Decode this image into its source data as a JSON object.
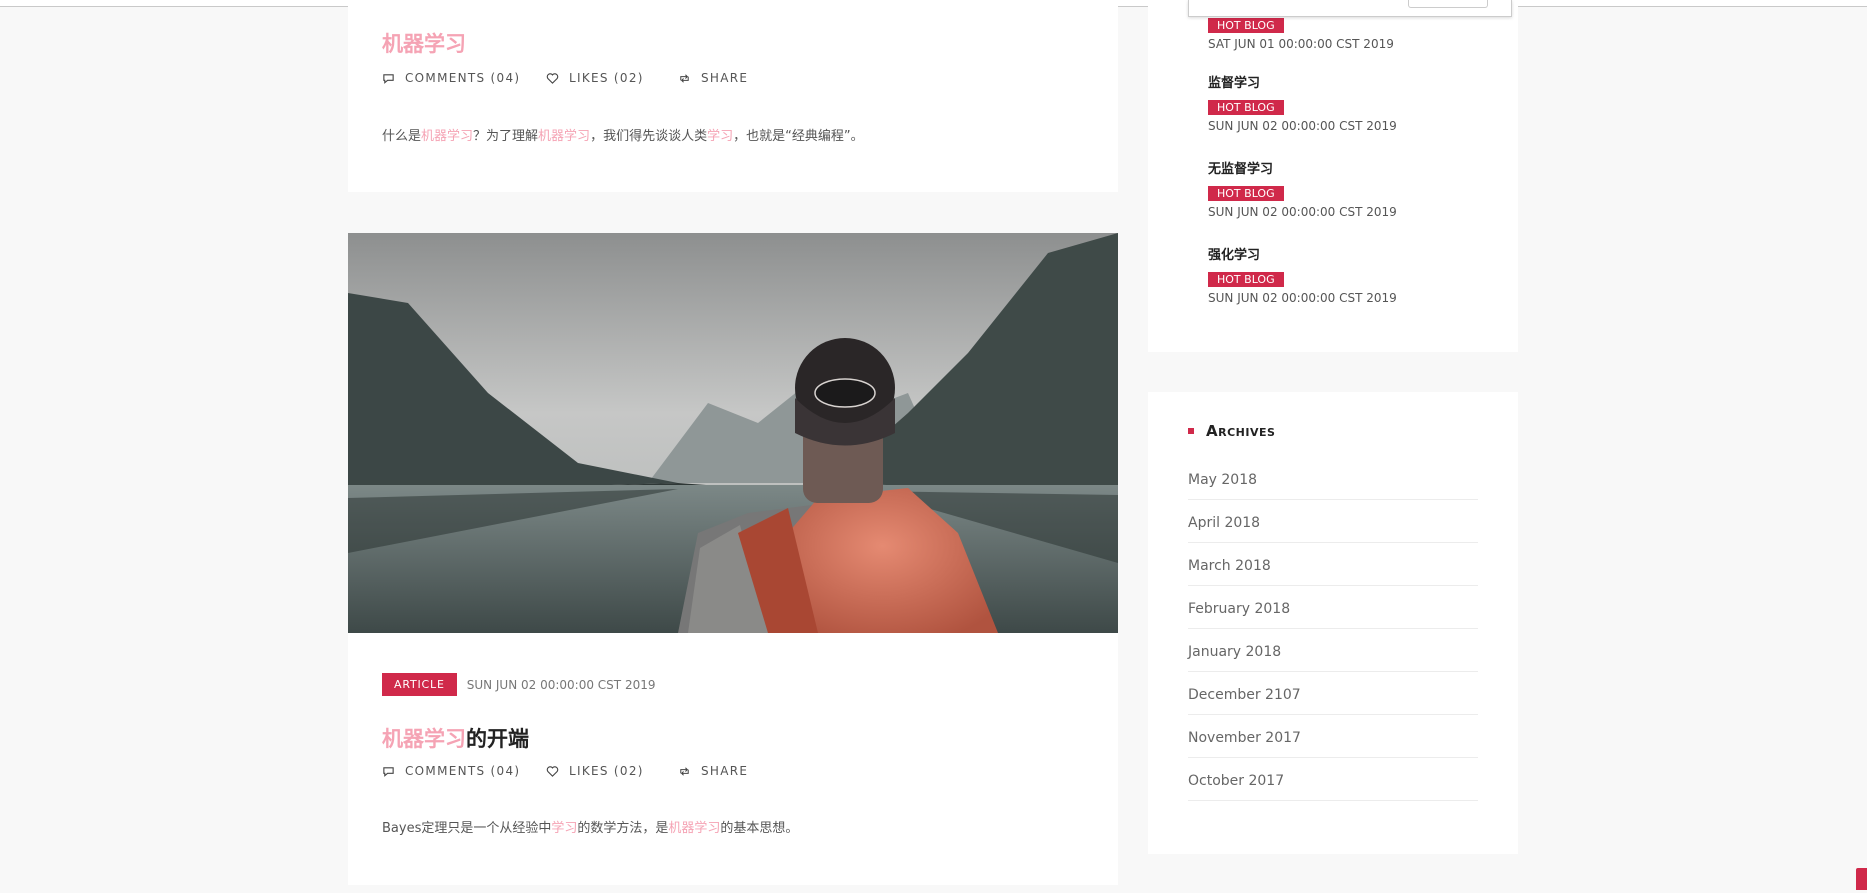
{
  "posts": [
    {
      "title_hl": "机器学习",
      "title_rest": "",
      "comments": "COMMENTS (04)",
      "likes": "LIKES (02)",
      "share": "SHARE",
      "excerpt": [
        {
          "t": "什么是",
          "hl": false
        },
        {
          "t": "机器学习",
          "hl": true
        },
        {
          "t": "？为了理解",
          "hl": false
        },
        {
          "t": "机器学习",
          "hl": true
        },
        {
          "t": "，我们得先谈谈人类",
          "hl": false
        },
        {
          "t": "学习",
          "hl": true
        },
        {
          "t": "，也就是“经典编程”。",
          "hl": false
        }
      ]
    },
    {
      "tag": "ARTICLE",
      "date": "SUN JUN 02 00:00:00 CST 2019",
      "title_hl": "机器学习",
      "title_rest": "的开端",
      "comments": "COMMENTS (04)",
      "likes": "LIKES (02)",
      "share": "SHARE",
      "excerpt": [
        {
          "t": "Bayes定理只是一个从经验中",
          "hl": false
        },
        {
          "t": "学习",
          "hl": true
        },
        {
          "t": "的数学方法，是",
          "hl": false
        },
        {
          "t": "机器学习",
          "hl": true
        },
        {
          "t": "的基本思想。",
          "hl": false
        }
      ]
    }
  ],
  "popular": [
    {
      "title": "",
      "badge": "HOT BLOG",
      "date": "SAT JUN 01 00:00:00 CST 2019"
    },
    {
      "title": "监督学习",
      "badge": "HOT BLOG",
      "date": "SUN JUN 02 00:00:00 CST 2019"
    },
    {
      "title": "无监督学习",
      "badge": "HOT BLOG",
      "date": "SUN JUN 02 00:00:00 CST 2019"
    },
    {
      "title": "强化学习",
      "badge": "HOT BLOG",
      "date": "SUN JUN 02 00:00:00 CST 2019"
    }
  ],
  "archives": {
    "title": "Archives",
    "items": [
      "May 2018",
      "April 2018",
      "March 2018",
      "February 2018",
      "January 2018",
      "December 2107",
      "November 2017",
      "October 2017"
    ]
  },
  "icons": {
    "comments": "comment-icon",
    "likes": "heart-icon",
    "share": "retweet-icon"
  },
  "colors": {
    "accent": "#d0294a",
    "highlight": "#f5a3b4"
  }
}
